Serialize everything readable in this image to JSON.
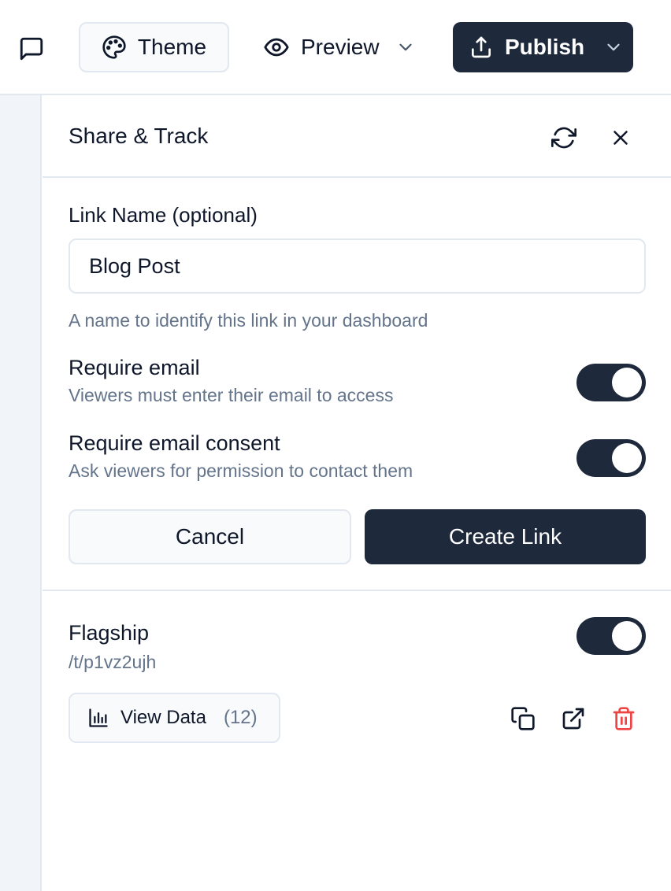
{
  "header": {
    "comment_icon": "message-square-icon",
    "theme_label": "Theme",
    "theme_icon": "palette-icon",
    "preview_label": "Preview",
    "preview_icon": "eye-icon",
    "publish_label": "Publish",
    "publish_icon": "upload-icon"
  },
  "panel": {
    "title": "Share & Track",
    "refresh_icon": "refresh-icon",
    "close_icon": "close-icon"
  },
  "form": {
    "link_name_label": "Link Name (optional)",
    "link_name_value": "Blog Post",
    "link_name_help": "A name to identify this link in your dashboard",
    "options": [
      {
        "title": "Require email",
        "description": "Viewers must enter their email to access",
        "enabled": true
      },
      {
        "title": "Require email consent",
        "description": "Ask viewers for permission to contact them",
        "enabled": true
      }
    ],
    "cancel_label": "Cancel",
    "create_label": "Create Link"
  },
  "links": [
    {
      "name": "Flagship",
      "path": "/t/p1vz2ujh",
      "enabled": true,
      "view_data_label": "View Data",
      "view_count": "(12)",
      "actions": [
        "copy-icon",
        "external-link-icon",
        "trash-icon"
      ]
    }
  ],
  "colors": {
    "primary": "#1e293b",
    "muted_text": "#64748b",
    "border": "#e2e8f0",
    "danger": "#ef4444"
  }
}
